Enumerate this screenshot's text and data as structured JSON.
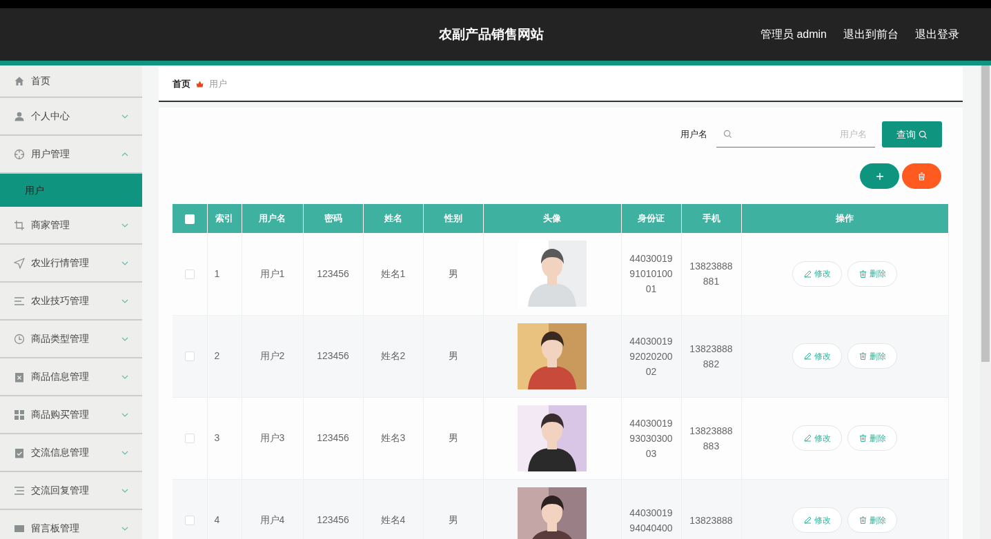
{
  "header": {
    "title": "农副产品销售网站",
    "links": [
      "管理员 admin",
      "退出到前台",
      "退出登录"
    ]
  },
  "sidebar": {
    "items": [
      {
        "kind": "link",
        "label": "首页"
      },
      {
        "kind": "menu",
        "label": "个人中心",
        "expanded": false
      },
      {
        "kind": "menu",
        "label": "用户管理",
        "expanded": true,
        "children": [
          {
            "label": "用户",
            "selected": true
          }
        ]
      },
      {
        "kind": "menu",
        "label": "商家管理",
        "expanded": false
      },
      {
        "kind": "menu",
        "label": "农业行情管理",
        "expanded": false
      },
      {
        "kind": "menu",
        "label": "农业技巧管理",
        "expanded": false
      },
      {
        "kind": "menu",
        "label": "商品类型管理",
        "expanded": false
      },
      {
        "kind": "menu",
        "label": "商品信息管理",
        "expanded": false
      },
      {
        "kind": "menu",
        "label": "商品购买管理",
        "expanded": false
      },
      {
        "kind": "menu",
        "label": "交流信息管理",
        "expanded": false
      },
      {
        "kind": "menu",
        "label": "交流回复管理",
        "expanded": false
      },
      {
        "kind": "menu",
        "label": "留言板管理",
        "expanded": false
      }
    ]
  },
  "breadcrumb": [
    "首页",
    "用户"
  ],
  "search": {
    "label": "用户名",
    "placeholder": "用户名",
    "button": "查询"
  },
  "table": {
    "all_checked": false,
    "columns": [
      "索引",
      "用户名",
      "密码",
      "姓名",
      "性别",
      "头像",
      "身份证",
      "手机",
      "操作"
    ],
    "rows": [
      {
        "checked": false,
        "index": "1",
        "username": "用户1",
        "password": "123456",
        "name": "姓名1",
        "gender": "男",
        "avatar": {
          "kind": "picture"
        },
        "id_card": "440300199101010001",
        "phone": "13823888881",
        "actions": [
          "修改",
          "删除"
        ]
      },
      {
        "checked": false,
        "index": "2",
        "username": "用户2",
        "password": "123456",
        "name": "姓名2",
        "gender": "男",
        "avatar": {
          "kind": "picture"
        },
        "id_card": "440300199202020002",
        "phone": "13823888882",
        "actions": [
          "修改",
          "删除"
        ]
      },
      {
        "checked": false,
        "index": "3",
        "username": "用户3",
        "password": "123456",
        "name": "姓名3",
        "gender": "男",
        "avatar": {
          "kind": "picture"
        },
        "id_card": "440300199303030003",
        "phone": "13823888883",
        "actions": [
          "修改",
          "删除"
        ]
      },
      {
        "checked": false,
        "index": "4",
        "username": "用户4",
        "password": "123456",
        "name": "姓名4",
        "gender": "男",
        "avatar": {
          "kind": "picture"
        },
        "id_card": "4403001994040400",
        "phone": "13823888",
        "actions": [
          "修改",
          "删除"
        ]
      }
    ]
  }
}
